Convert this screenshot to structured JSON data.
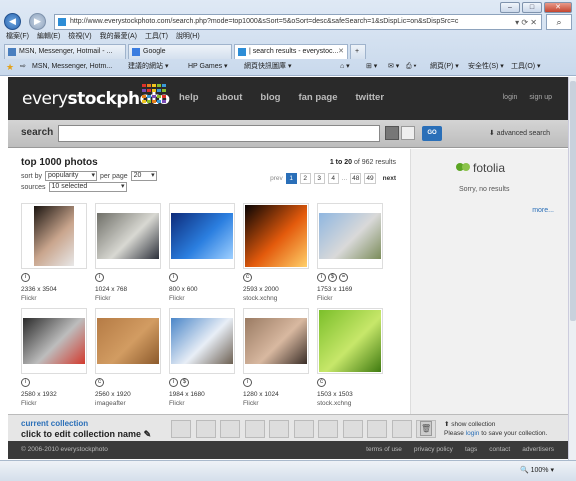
{
  "browser": {
    "address": "http://www.everystockphoto.com/search.php?mode=top1000&sSort=5&oSort=desc&safeSearch=1&sDispLic=on&sDispSrc=c",
    "menu": [
      "檔案(F)",
      "編輯(E)",
      "檢視(V)",
      "我的最愛(A)",
      "工具(T)",
      "說明(H)"
    ],
    "tabs": [
      {
        "label": "MSN, Messenger, Hotmail - ..."
      },
      {
        "label": "Google"
      },
      {
        "label": "| search results - everystoc..."
      }
    ],
    "favorites": [
      "MSN, Messenger, Hotm...",
      "建議的網站 ▾",
      "HP Games ▾",
      "網頁快訊圖庫 ▾"
    ],
    "command_items": [
      "網頁(P) ▾",
      "安全性(S) ▾",
      "工具(O) ▾"
    ],
    "zoom": "100%"
  },
  "header": {
    "logo_light": "every",
    "logo_bold": "stockphoto",
    "nav": [
      "help",
      "about",
      "blog",
      "fan page",
      "twitter"
    ],
    "login": "login",
    "signup": "sign up",
    "logo_colors": [
      "#e0322a",
      "#e57f1b",
      "#f1c61f",
      "#8bbf2b",
      "#3a9ad9",
      "#7b4bb5",
      "#e0322a",
      "#f1c61f",
      "#3a9ad9",
      "#8bbf2b",
      "#e57f1b",
      "#3a9ad9",
      "#7b4bb5",
      "#8bbf2b",
      "#e0322a",
      "#f1c61f",
      "#8bbf2b",
      "#e57f1b",
      "#3a9ad9",
      "#7b4bb5"
    ]
  },
  "search": {
    "label": "search",
    "go": "GO",
    "advanced": "advanced search"
  },
  "results": {
    "title": "top 1000 photos",
    "count_prefix": "1 to 20",
    "count_suffix": "of 962 results",
    "sort_label": "sort by",
    "sort_value": "popularity",
    "per_page_label": "per page",
    "per_page_value": "20",
    "sources_label": "sources",
    "sources_value": "10 selected",
    "pager": {
      "prev": "prev",
      "pages": [
        "1",
        "2",
        "3",
        "4"
      ],
      "ellipsis": "...",
      "last_pages": [
        "48",
        "49"
      ],
      "next": "next"
    }
  },
  "photos": [
    {
      "dims": "2336 x 3504",
      "source": "Flickr",
      "licenses": [
        "i"
      ],
      "colors": [
        "#1a1410",
        "#c9a58d",
        "#e8e8e8"
      ],
      "shape": "portrait"
    },
    {
      "dims": "1024 x 768",
      "source": "Flickr",
      "licenses": [
        "i"
      ],
      "colors": [
        "#6f6f68",
        "#d8d8d2",
        "#2b2f3a"
      ],
      "shape": "landscape"
    },
    {
      "dims": "800 x 600",
      "source": "Flickr",
      "licenses": [
        "i"
      ],
      "colors": [
        "#0d2b7a",
        "#2b7fe0",
        "#9fd0ff"
      ],
      "shape": "landscape"
    },
    {
      "dims": "2593 x 2000",
      "source": "stock.xchng",
      "licenses": [
        "c"
      ],
      "colors": [
        "#080404",
        "#e35a0c",
        "#ffd06a"
      ],
      "shape": "landscape-tall"
    },
    {
      "dims": "1753 x 1169",
      "source": "Flickr",
      "licenses": [
        "i",
        "$",
        "="
      ],
      "colors": [
        "#8fb6e0",
        "#d9d9d9",
        "#7b8c5a"
      ],
      "shape": "landscape"
    },
    {
      "dims": "2580 x 1932",
      "source": "Flickr",
      "licenses": [
        "i"
      ],
      "colors": [
        "#2a2a2a",
        "#bdbdbd",
        "#d23a2e"
      ],
      "shape": "landscape"
    },
    {
      "dims": "2560 x 1920",
      "source": "imageafter",
      "licenses": [
        "c"
      ],
      "colors": [
        "#b57b45",
        "#d29c62",
        "#8c5a2c"
      ],
      "shape": "landscape"
    },
    {
      "dims": "1984 x 1680",
      "source": "Flickr",
      "licenses": [
        "i",
        "$"
      ],
      "colors": [
        "#4a86c8",
        "#e8eef6",
        "#6d6052"
      ],
      "shape": "landscape"
    },
    {
      "dims": "1280 x 1024",
      "source": "Flickr",
      "licenses": [
        "i"
      ],
      "colors": [
        "#9a7b63",
        "#d8b8a0",
        "#3a2e28"
      ],
      "shape": "landscape"
    },
    {
      "dims": "1503 x 1503",
      "source": "stock.xchng",
      "licenses": [
        "c"
      ],
      "colors": [
        "#7bbf2a",
        "#c7e76a",
        "#3f7a10"
      ],
      "shape": "square"
    }
  ],
  "sidebar": {
    "brand": "fotolia",
    "no_results": "Sorry, no results",
    "more": "more..."
  },
  "collection": {
    "title": "current collection",
    "edit": "click to edit collection name",
    "show": "show collection",
    "please": "Please",
    "login": "login",
    "save_text": "to save your collection."
  },
  "footer": {
    "copyright": "© 2006-2010 everystockphoto",
    "links": [
      "terms of use",
      "privacy policy",
      "tags",
      "contact",
      "advertisers"
    ]
  }
}
